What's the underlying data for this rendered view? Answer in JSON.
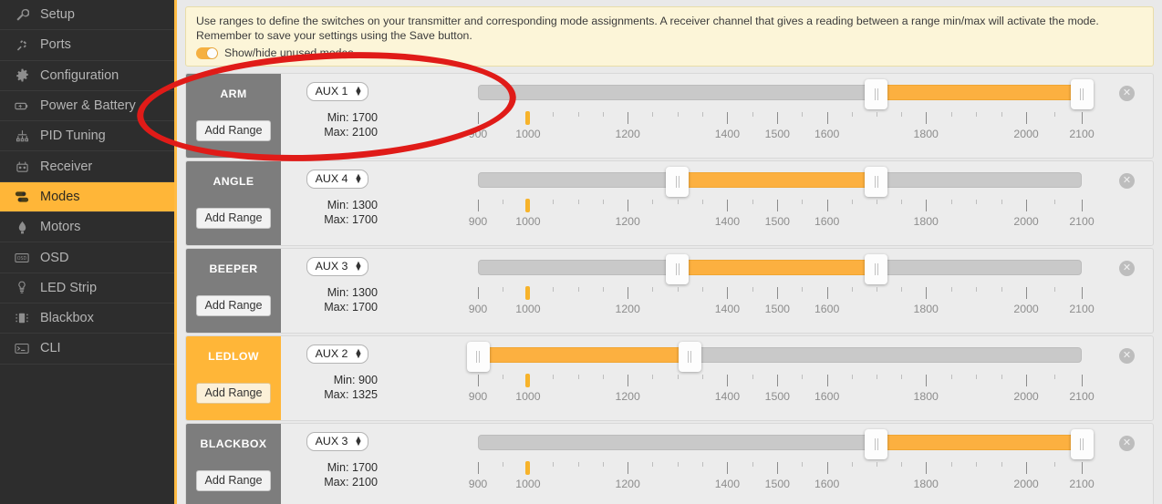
{
  "sidebar": {
    "items": [
      {
        "label": "Setup",
        "icon": "wrench-icon",
        "active": false
      },
      {
        "label": "Ports",
        "icon": "plug-icon",
        "active": false
      },
      {
        "label": "Configuration",
        "icon": "gear-icon",
        "active": false
      },
      {
        "label": "Power & Battery",
        "icon": "battery-icon",
        "active": false
      },
      {
        "label": "PID Tuning",
        "icon": "sliders-icon",
        "active": false
      },
      {
        "label": "Receiver",
        "icon": "transmitter-icon",
        "active": false
      },
      {
        "label": "Modes",
        "icon": "toggles-icon",
        "active": true
      },
      {
        "label": "Motors",
        "icon": "motor-icon",
        "active": false
      },
      {
        "label": "OSD",
        "icon": "osd-icon",
        "active": false
      },
      {
        "label": "LED Strip",
        "icon": "led-icon",
        "active": false
      },
      {
        "label": "Blackbox",
        "icon": "blackbox-icon",
        "active": false
      },
      {
        "label": "CLI",
        "icon": "terminal-icon",
        "active": false
      }
    ]
  },
  "banner": {
    "text": "Use ranges to define the switches on your transmitter and corresponding mode assignments. A receiver channel that gives a reading between a range min/max will activate the mode. Remember to save your settings using the Save button.",
    "toggle_label": "Show/hide unused modes",
    "toggle_on": true
  },
  "scale": {
    "range_min": 900,
    "range_max": 2100,
    "major_ticks": [
      900,
      1000,
      1200,
      1400,
      1500,
      1600,
      1800,
      2000,
      2100
    ],
    "minor_step": 50,
    "current_value": 1000
  },
  "labels": {
    "add_range": "Add Range",
    "min_prefix": "Min: ",
    "max_prefix": "Max: ",
    "close": "✕"
  },
  "modes": [
    {
      "name": "ARM",
      "channel": "AUX 1",
      "min": 1700,
      "max": 2100,
      "active": false
    },
    {
      "name": "ANGLE",
      "channel": "AUX 4",
      "min": 1300,
      "max": 1700,
      "active": false
    },
    {
      "name": "BEEPER",
      "channel": "AUX 3",
      "min": 1300,
      "max": 1700,
      "active": false
    },
    {
      "name": "LEDLOW",
      "channel": "AUX 2",
      "min": 900,
      "max": 1325,
      "active": true
    },
    {
      "name": "BLACKBOX",
      "channel": "AUX 3",
      "min": 1700,
      "max": 2100,
      "active": false
    }
  ],
  "colors": {
    "accent": "#ffb638",
    "fill": "#fcb040",
    "annotation": "#e01b18",
    "sidebar_bg": "#2d2d2d"
  }
}
